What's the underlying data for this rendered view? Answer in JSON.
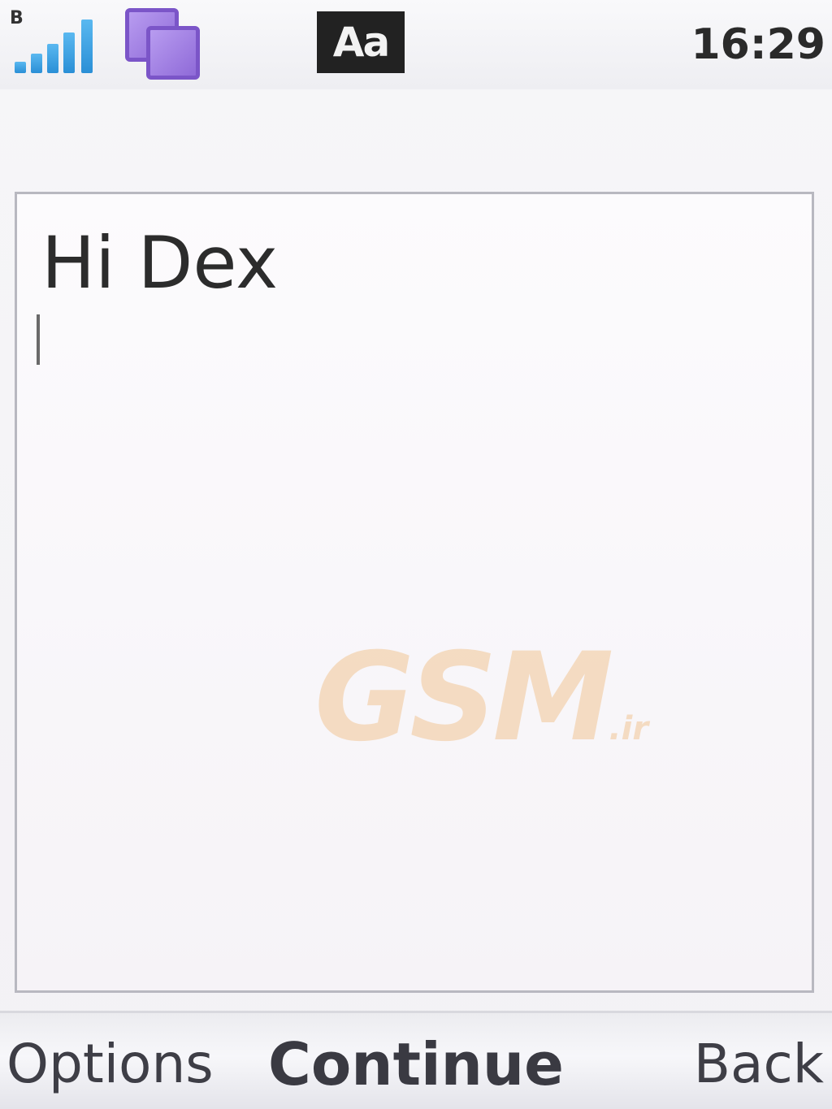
{
  "status_bar": {
    "signal_mark": "B",
    "signal_level": 5,
    "input_mode": "Aa",
    "time": "16:29"
  },
  "editor": {
    "text": "Hi Dex"
  },
  "watermark": {
    "brand": "GSM",
    "suffix": ".ir"
  },
  "softkeys": {
    "left": "Options",
    "center": "Continue",
    "right": "Back"
  },
  "colors": {
    "signal": "#2a8fd6",
    "multitask": "#7b55c8",
    "watermark": "#f3d3b0"
  },
  "icons": {
    "signal": "signal-strength-icon",
    "multitask": "multitask-icon",
    "input_mode": "text-input-mode-icon"
  }
}
